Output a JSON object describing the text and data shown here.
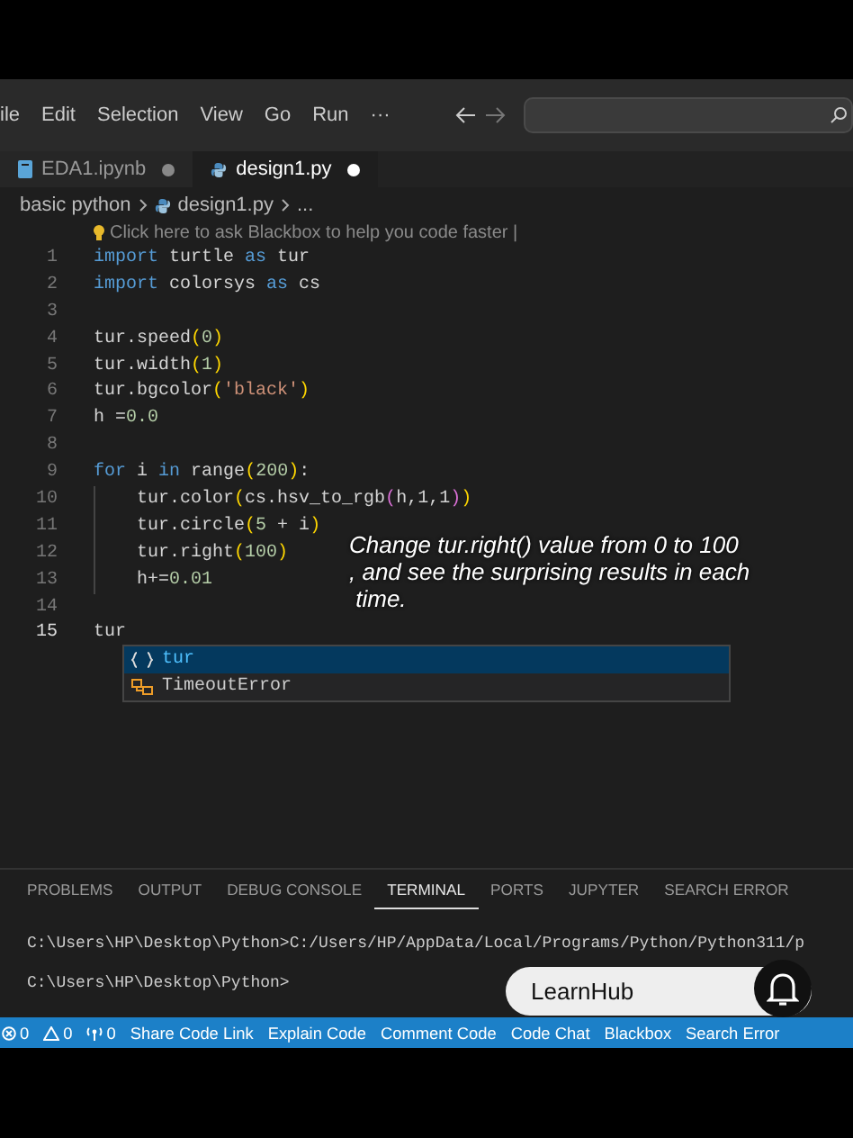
{
  "menu": [
    "ile",
    "Edit",
    "Selection",
    "View",
    "Go",
    "Run",
    "···"
  ],
  "tabs": [
    {
      "label": "EDA1.ipynb",
      "kind": "notebook",
      "selected": false,
      "modified": true
    },
    {
      "label": "design1.py",
      "kind": "python",
      "selected": true,
      "modified": true
    }
  ],
  "breadcrumb": [
    "basic python",
    "design1.py",
    "..."
  ],
  "hint": "Click here to ask Blackbox to help you code faster |",
  "code": [
    {
      "number": "1",
      "tokens": [
        {
          "kind": "keyword",
          "text": "import"
        },
        {
          "kind": "plain",
          "text": " turtle "
        },
        {
          "kind": "keyword",
          "text": "as"
        },
        {
          "kind": "plain",
          "text": " tur"
        }
      ]
    },
    {
      "number": "2",
      "tokens": [
        {
          "kind": "keyword",
          "text": "import"
        },
        {
          "kind": "plain",
          "text": " colorsys "
        },
        {
          "kind": "keyword",
          "text": "as"
        },
        {
          "kind": "plain",
          "text": " cs"
        }
      ]
    },
    {
      "number": "3"
    },
    {
      "number": "4",
      "tokens": [
        {
          "kind": "plain",
          "text": "tur.speed"
        },
        {
          "kind": "paren",
          "text": "("
        },
        {
          "kind": "number",
          "text": "0"
        },
        {
          "kind": "paren",
          "text": ")"
        }
      ]
    },
    {
      "number": "5",
      "tokens": [
        {
          "kind": "plain",
          "text": "tur.width"
        },
        {
          "kind": "paren",
          "text": "("
        },
        {
          "kind": "number",
          "text": "1"
        },
        {
          "kind": "paren",
          "text": ")"
        }
      ]
    },
    {
      "number": "6",
      "tokens": [
        {
          "kind": "plain",
          "text": "tur.bgcolor"
        },
        {
          "kind": "paren",
          "text": "("
        },
        {
          "kind": "string",
          "text": "'black'"
        },
        {
          "kind": "paren",
          "text": ")"
        }
      ]
    },
    {
      "number": "7",
      "tokens": [
        {
          "kind": "plain",
          "text": "h ="
        },
        {
          "kind": "number",
          "text": "0.0"
        }
      ]
    },
    {
      "number": "8"
    },
    {
      "number": "9",
      "tokens": [
        {
          "kind": "keyword",
          "text": "for"
        },
        {
          "kind": "plain",
          "text": " i "
        },
        {
          "kind": "keyword",
          "text": "in"
        },
        {
          "kind": "plain",
          "text": " range"
        },
        {
          "kind": "paren",
          "text": "("
        },
        {
          "kind": "number",
          "text": "200"
        },
        {
          "kind": "paren",
          "text": ")"
        },
        {
          "kind": "plain",
          "text": ":"
        }
      ]
    },
    {
      "number": "10",
      "indented": true,
      "tokens": [
        {
          "kind": "plain",
          "text": "tur.color"
        },
        {
          "kind": "paren",
          "text": "("
        },
        {
          "kind": "plain",
          "text": "cs.hsv_to_rgb"
        },
        {
          "kind": "paren2",
          "text": "("
        },
        {
          "kind": "plain",
          "text": "h,1,1"
        },
        {
          "kind": "paren2",
          "text": ")"
        },
        {
          "kind": "paren",
          "text": ")"
        }
      ]
    },
    {
      "number": "11",
      "indented": true,
      "tokens": [
        {
          "kind": "plain",
          "text": "tur.circle"
        },
        {
          "kind": "paren",
          "text": "("
        },
        {
          "kind": "number",
          "text": "5"
        },
        {
          "kind": "plain",
          "text": " + i"
        },
        {
          "kind": "paren",
          "text": ")"
        }
      ]
    },
    {
      "number": "12",
      "indented": true,
      "tokens": [
        {
          "kind": "plain",
          "text": "tur.right"
        },
        {
          "kind": "paren",
          "text": "("
        },
        {
          "kind": "number",
          "text": "100"
        },
        {
          "kind": "paren",
          "text": ")"
        }
      ]
    },
    {
      "number": "13",
      "indented": true,
      "tokens": [
        {
          "kind": "plain",
          "text": "h+="
        },
        {
          "kind": "number",
          "text": "0.01"
        }
      ]
    },
    {
      "number": "14"
    },
    {
      "number": "15",
      "current": true,
      "tokens": [
        {
          "kind": "plain",
          "text": "tur"
        }
      ]
    }
  ],
  "suggestions": [
    {
      "label": "tur",
      "kind": "module",
      "selected": true
    },
    {
      "label": "TimeoutError",
      "kind": "class",
      "selected": false
    }
  ],
  "caption": [
    "Change tur.right() value from 0 to 100",
    ", and see the surprising results in each",
    " time."
  ],
  "panel_tabs": [
    {
      "label": "PROBLEMS",
      "selected": false
    },
    {
      "label": "OUTPUT",
      "selected": false
    },
    {
      "label": "DEBUG CONSOLE",
      "selected": false
    },
    {
      "label": "TERMINAL",
      "selected": true
    },
    {
      "label": "PORTS",
      "selected": false
    },
    {
      "label": "JUPYTER",
      "selected": false
    },
    {
      "label": "SEARCH ERROR",
      "selected": false
    }
  ],
  "terminal": [
    "C:\\Users\\HP\\Desktop\\Python>C:/Users/HP/AppData/Local/Programs/Python/Python311/p",
    "C:\\Users\\HP\\Desktop\\Python>"
  ],
  "status_bar": [
    {
      "kind": "errors",
      "text": "0"
    },
    {
      "kind": "warnings",
      "text": "0"
    },
    {
      "kind": "ports",
      "text": "0"
    },
    {
      "kind": "text",
      "text": "Share Code Link"
    },
    {
      "kind": "text",
      "text": "Explain Code"
    },
    {
      "kind": "text",
      "text": "Comment Code"
    },
    {
      "kind": "text",
      "text": "Code Chat"
    },
    {
      "kind": "text",
      "text": "Blackbox"
    },
    {
      "kind": "text",
      "text": "Search Error"
    }
  ],
  "overlay": {
    "label": "LearnHub"
  }
}
